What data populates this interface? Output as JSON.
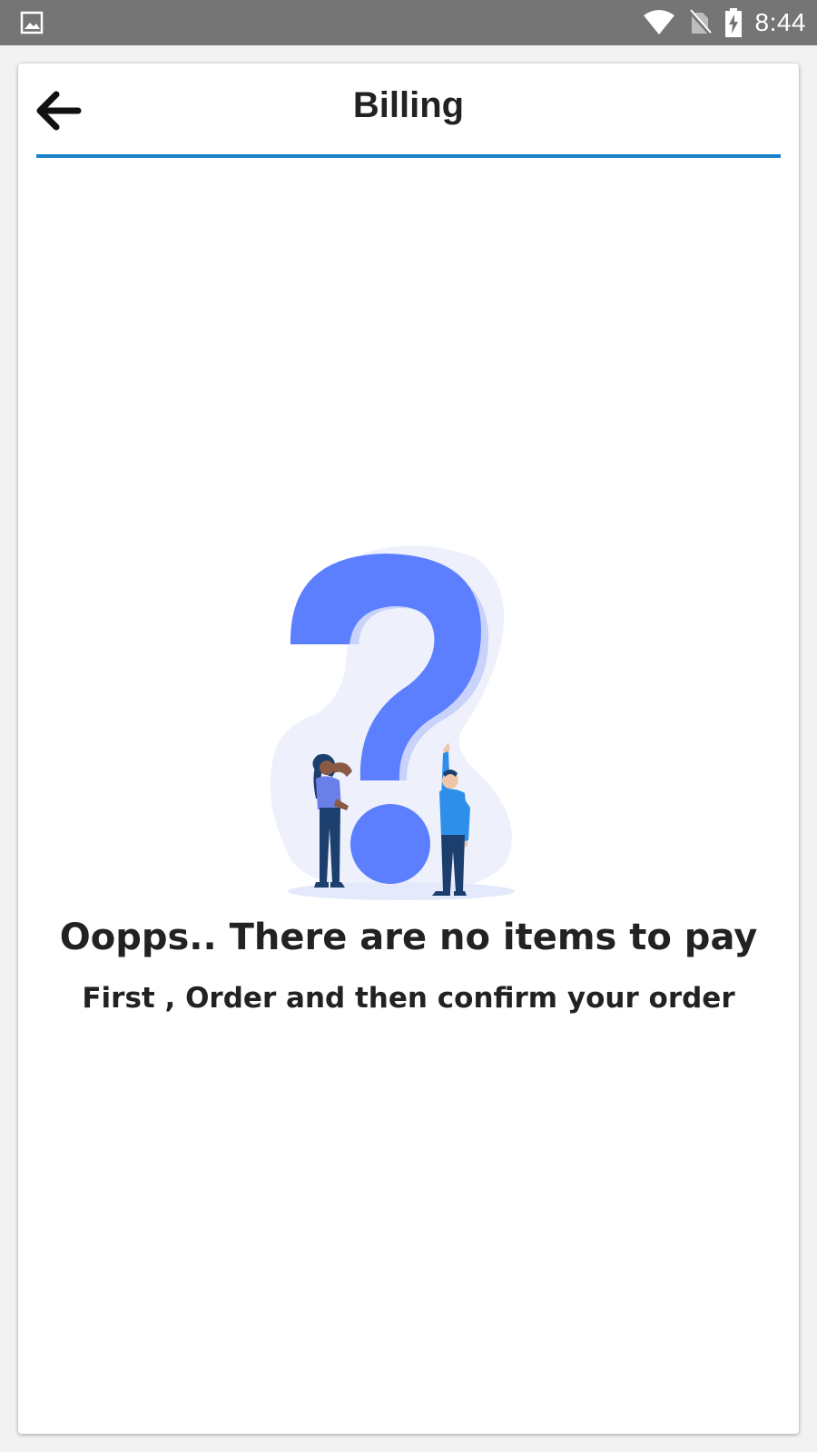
{
  "status_bar": {
    "time": "8:44",
    "icons": [
      "image-icon",
      "wifi-icon",
      "no-sim-icon",
      "battery-charging-icon"
    ]
  },
  "header": {
    "title": "Billing",
    "back_icon": "arrow-left-icon"
  },
  "empty_state": {
    "illustration": "question-mark-people-illustration",
    "title": "Oopps.. There are no items to pay",
    "subtitle": "First , Order and then confirm your order"
  },
  "colors": {
    "accent": "#1a82c8",
    "illustration_primary": "#5b7fff",
    "illustration_bg": "#eef1fc",
    "text": "#222222",
    "status_bar": "#757575"
  }
}
